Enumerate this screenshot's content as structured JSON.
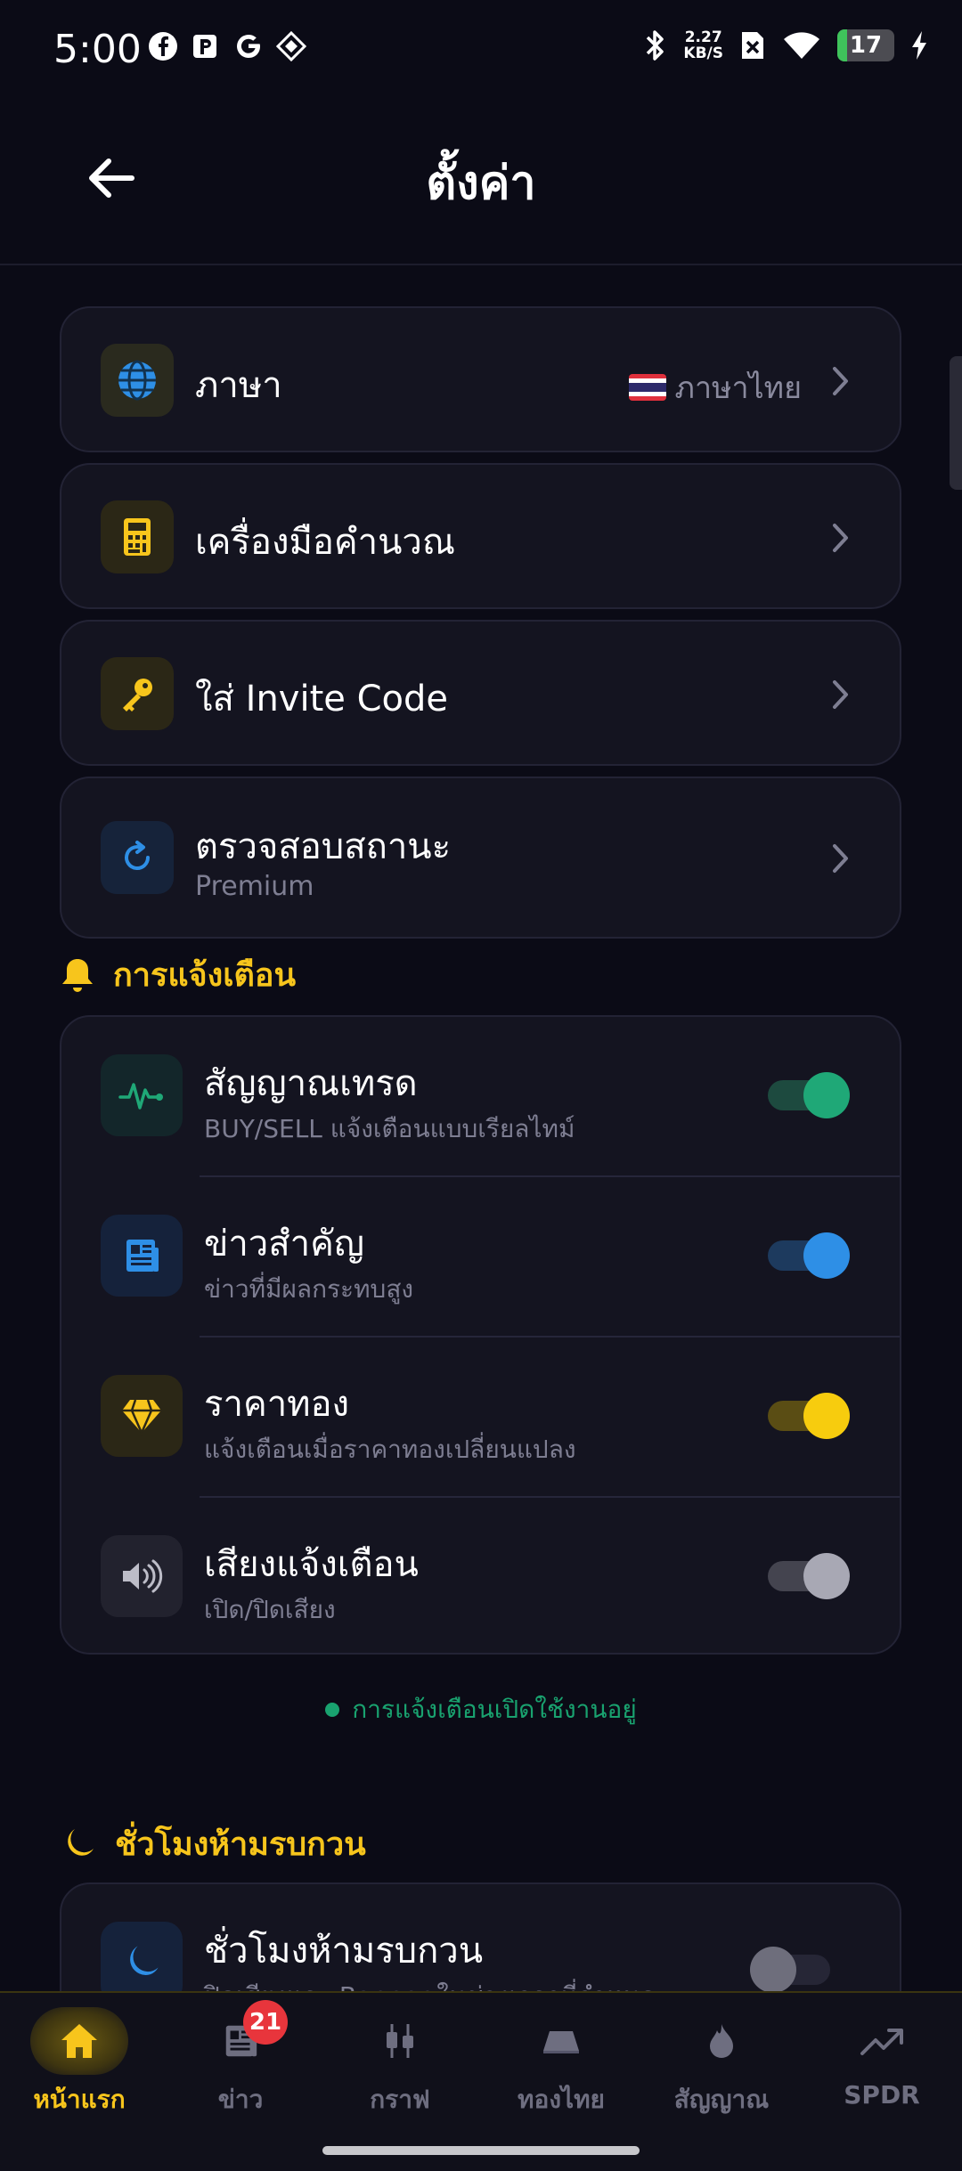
{
  "status_bar": {
    "time": "5:00",
    "speed_value": "2.27",
    "speed_unit": "KB/S",
    "battery": "17",
    "left_icons": [
      "facebook-icon",
      "parking-app-icon",
      "google-icon",
      "app-icon"
    ]
  },
  "header": {
    "title": "ตั้งค่า"
  },
  "settings": {
    "language": {
      "title": "ภาษา",
      "value": "ภาษาไทย"
    },
    "calculator": {
      "title": "เครื่องมือคำนวณ"
    },
    "invite": {
      "title": "ใส่ Invite Code"
    },
    "status": {
      "title": "ตรวจสอบสถานะ",
      "subtitle": "Premium"
    }
  },
  "notifications": {
    "section_label": "การแจ้งเตือน",
    "items": [
      {
        "title": "สัญญาณเทรด",
        "subtitle": "BUY/SELL แจ้งเตือนแบบเรียลไทม์",
        "enabled": true,
        "color": "#1fa877"
      },
      {
        "title": "ข่าวสำคัญ",
        "subtitle": "ข่าวที่มีผลกระทบสูง",
        "enabled": true,
        "color": "#2e8fe6"
      },
      {
        "title": "ราคาทอง",
        "subtitle": "แจ้งเตือนเมื่อราคาทองเปลี่ยนแปลง",
        "enabled": true,
        "color": "#f7cc0e"
      },
      {
        "title": "เสียงแจ้งเตือน",
        "subtitle": "เปิด/ปิดเสียง",
        "enabled": true,
        "color": "#a8a8b4"
      }
    ],
    "status_text": "การแจ้งเตือนเปิดใช้งานอยู่"
  },
  "dnd": {
    "section_label": "ชั่วโมงห้ามรบกวน",
    "item": {
      "title": "ชั่วโมงห้ามรบกวน",
      "subtitle": "ปิดเสียงและ Banner ในช่วงเวลาที่กำหนด",
      "enabled": false
    }
  },
  "bottom_nav": {
    "items": [
      {
        "label": "หน้าแรก",
        "icon": "home-icon",
        "active": true
      },
      {
        "label": "ข่าว",
        "icon": "news-icon",
        "badge": "21"
      },
      {
        "label": "กราฟ",
        "icon": "candlestick-icon"
      },
      {
        "label": "ทองไทย",
        "icon": "gold-bar-icon"
      },
      {
        "label": "สัญญาณ",
        "icon": "flame-icon"
      },
      {
        "label": "SPDR",
        "icon": "trend-up-icon"
      }
    ]
  },
  "colors": {
    "accent": "#f7c51c",
    "background": "#0b0b16",
    "card": "#141420",
    "success": "#19a26f"
  }
}
